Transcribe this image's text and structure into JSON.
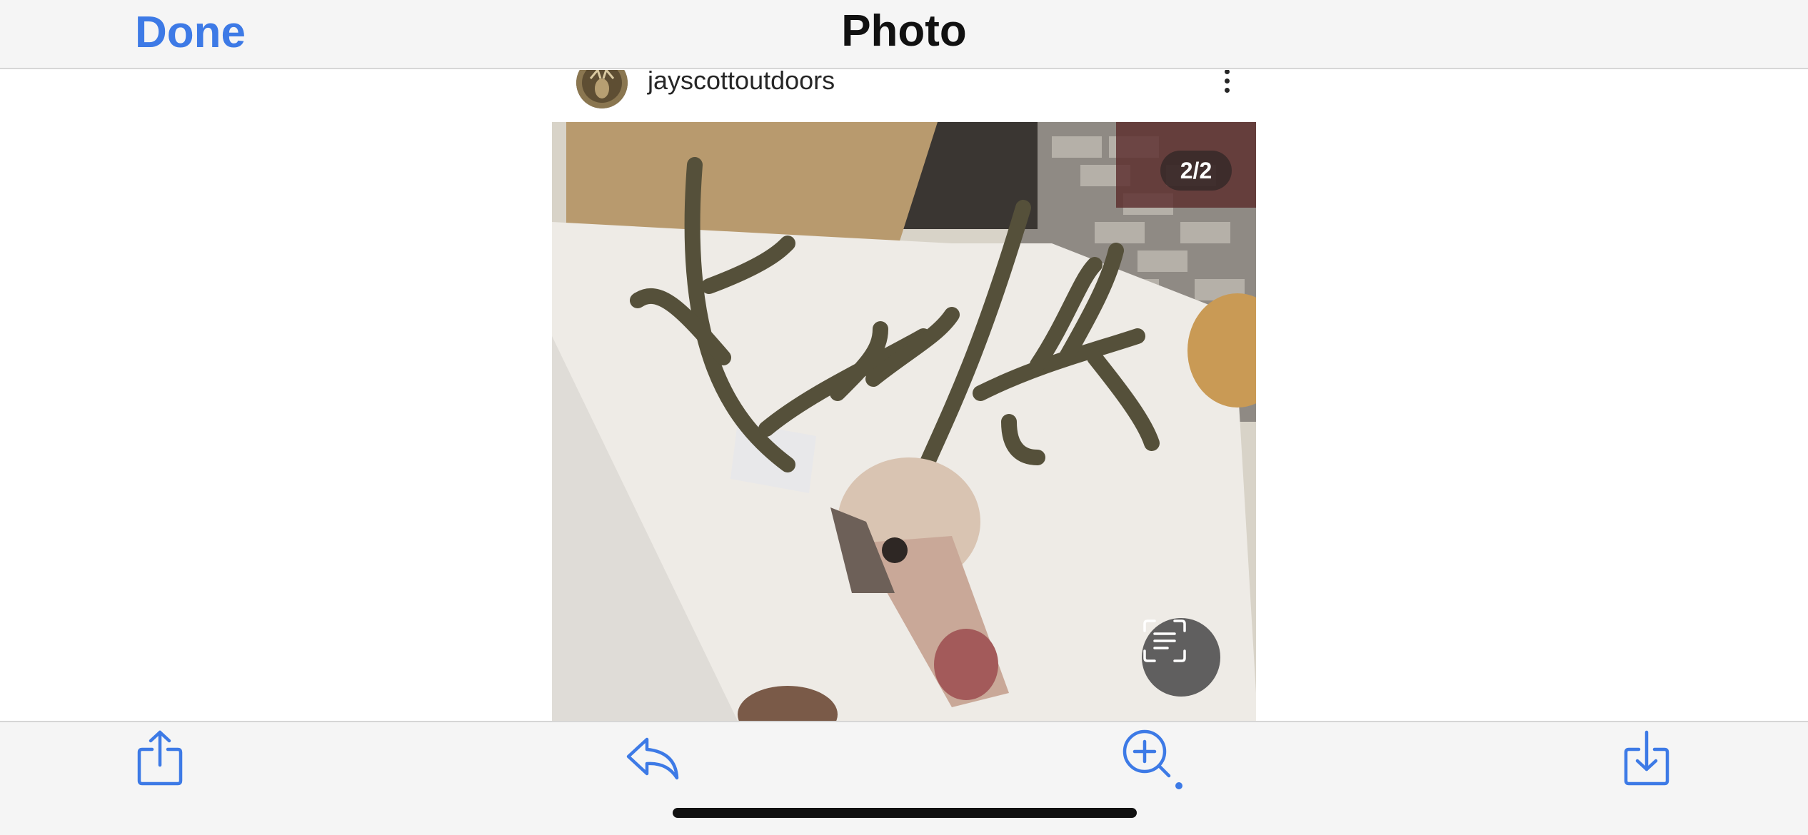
{
  "header": {
    "done_label": "Done",
    "title": "Photo"
  },
  "post": {
    "username": "jayscottoutdoors",
    "image_counter": "2/2",
    "image_subject": "deer antlers on table"
  },
  "toolbar": {
    "items": [
      "share-icon",
      "reply-icon",
      "zoom-in-icon",
      "download-icon"
    ]
  },
  "colors": {
    "accent": "#3d7ae6",
    "bar_background": "#f5f5f5"
  }
}
